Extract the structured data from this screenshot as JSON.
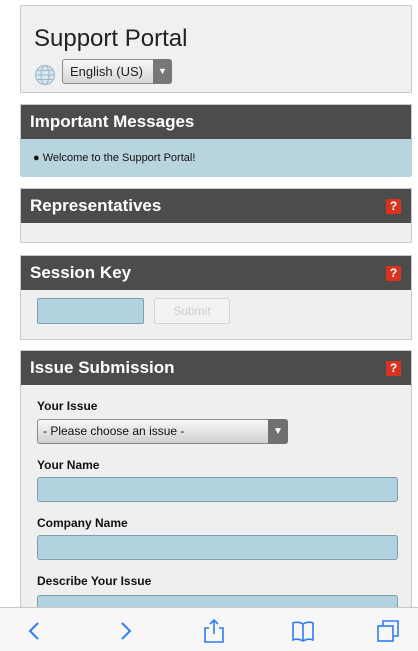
{
  "header": {
    "title": "Support Portal",
    "language": {
      "selected": "English (US)",
      "globe_icon": "globe-icon",
      "arrow_icon": "chevron-down-icon"
    }
  },
  "messages": {
    "heading": "Important Messages",
    "items": [
      "Welcome to the Support Portal!"
    ]
  },
  "representatives": {
    "heading": "Representatives",
    "help_label": "?"
  },
  "session_key": {
    "heading": "Session Key",
    "help_label": "?",
    "input_value": "",
    "submit_label": "Submit"
  },
  "issue_submission": {
    "heading": "Issue Submission",
    "help_label": "?",
    "your_issue_label": "Your Issue",
    "issue_selected": "- Please choose an issue -",
    "your_name_label": "Your Name",
    "company_name_label": "Company Name",
    "describe_label": "Describe Your Issue"
  },
  "toolbar": {
    "icons": [
      "back-icon",
      "forward-icon",
      "share-icon",
      "bookmarks-icon",
      "tabs-icon"
    ]
  },
  "colors": {
    "header_bg": "#4c4c4c",
    "field_bg": "#b3d2df",
    "help_badge": "#d9321d"
  }
}
